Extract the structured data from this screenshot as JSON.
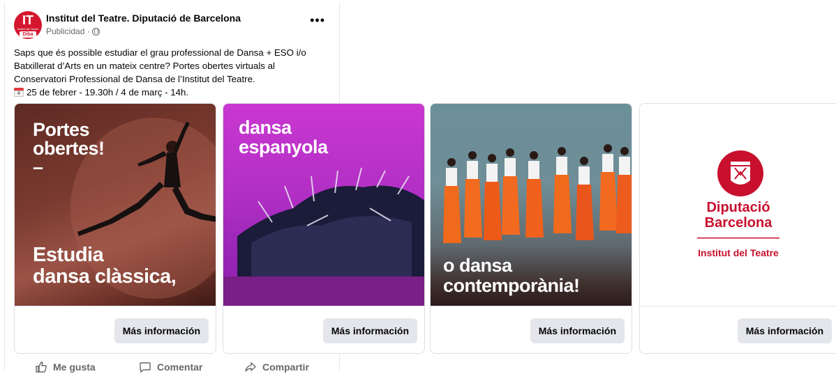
{
  "post": {
    "page_name": "Institut del Teatre. Diputació de Barcelona",
    "sponsored": "Publicidad ·",
    "avatar": {
      "main": "IT",
      "small": "Institut del Teatre",
      "badge": "Diba"
    },
    "more_label": "•••",
    "text_lines": [
      "Saps que és possible estudiar el grau professional de Dansa + ESO i/o",
      "Batxillerat d’Arts en un mateix centre? Portes obertes virtuals al",
      "Conservatori Professional de Dansa de l’Institut del Teatre."
    ],
    "date_line": "25 de febrer - 19.30h / 4 de març - 14h.",
    "calendar_icon_text": "4"
  },
  "cards": [
    {
      "overlay_top": [
        "Portes",
        "obertes!",
        "–"
      ],
      "overlay_bottom": [
        "Estudia",
        "dansa clàssica,"
      ],
      "cta": "Más información"
    },
    {
      "overlay_top": [
        "dansa",
        "espanyola"
      ],
      "cta": "Más información"
    },
    {
      "overlay_bottom": [
        "o dansa",
        "contemporània!"
      ],
      "cta": "Más información"
    },
    {
      "brand_line1": "Diputació",
      "brand_line2": "Barcelona",
      "brand_line3": "Institut del Teatre",
      "cta": "Más información"
    }
  ],
  "actions": {
    "like": "Me gusta",
    "comment": "Comentar",
    "share": "Compartir"
  },
  "colors": {
    "diba_red": "#c8102e",
    "cta_bg": "#e4e6eb",
    "muted": "#65676b"
  },
  "icons": [
    "like-icon",
    "comment-icon",
    "share-icon",
    "globe-icon",
    "more-options-icon",
    "calendar-icon"
  ]
}
